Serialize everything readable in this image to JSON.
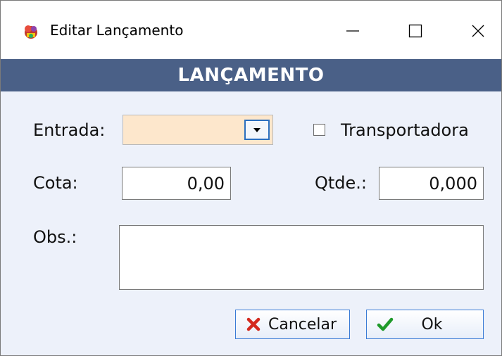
{
  "window": {
    "title": "Editar Lançamento",
    "controls": {
      "minimize": "—",
      "maximize": "☐",
      "close": "✕"
    }
  },
  "header": {
    "title": "LANÇAMENTO"
  },
  "form": {
    "entrada": {
      "label": "Entrada:",
      "value": ""
    },
    "transportadora": {
      "label": "Transportadora",
      "checked": false
    },
    "cota": {
      "label": "Cota:",
      "value": "0,00"
    },
    "qtde": {
      "label": "Qtde.:",
      "value": "0,000"
    },
    "obs": {
      "label": "Obs.:",
      "value": ""
    }
  },
  "buttons": {
    "cancel": {
      "label": "Cancelar",
      "icon": "x-icon",
      "icon_color": "#d42a1f"
    },
    "ok": {
      "label": "Ok",
      "icon": "check-icon",
      "icon_color": "#1f9a2a"
    }
  },
  "colors": {
    "header_bg": "#4a6087",
    "window_bg": "#edf1fa",
    "combo_bg": "#fde7cc",
    "accent_border": "#3a7bd5"
  }
}
